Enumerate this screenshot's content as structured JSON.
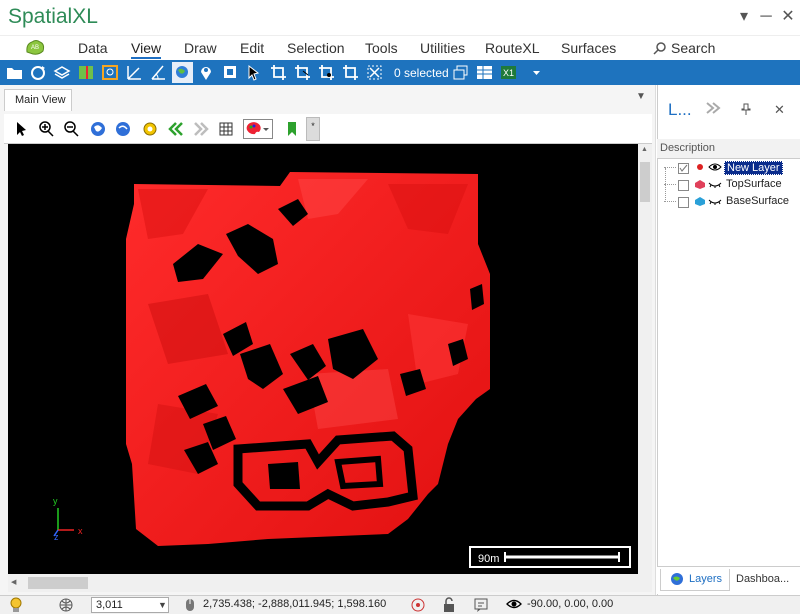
{
  "app": {
    "title": "SpatialXL"
  },
  "window": {
    "min": "─",
    "max": "□",
    "close": "✕",
    "menu": "▾"
  },
  "ribbon": {
    "tabs": [
      "Data",
      "View",
      "Draw",
      "Edit",
      "Selection",
      "Tools",
      "Utilities",
      "RouteXL",
      "Surfaces"
    ],
    "active_tab": "View",
    "search_label": "Search"
  },
  "toolbar": {
    "selected_count": "0 selected"
  },
  "document": {
    "tab_label": "Main View"
  },
  "map": {
    "background": "#000000",
    "fill_color": "#ff1a1a",
    "scale_label": "90m",
    "axis": {
      "x": "x",
      "y": "y",
      "z": "z"
    }
  },
  "layers_panel": {
    "title": "L...",
    "column_header": "Description",
    "layers": [
      {
        "name": "New Layer",
        "checked": true,
        "selected": true
      },
      {
        "name": "TopSurface",
        "checked": false,
        "selected": false
      },
      {
        "name": "BaseSurface",
        "checked": false,
        "selected": false
      }
    ],
    "bottom_tabs": [
      "Layers",
      "Dashboa..."
    ]
  },
  "status": {
    "zoom": "3,011",
    "coords": "2,735.438; -2,888,011.945; 1,598.160",
    "view_angles": "-90.00, 0.00, 0.00"
  }
}
